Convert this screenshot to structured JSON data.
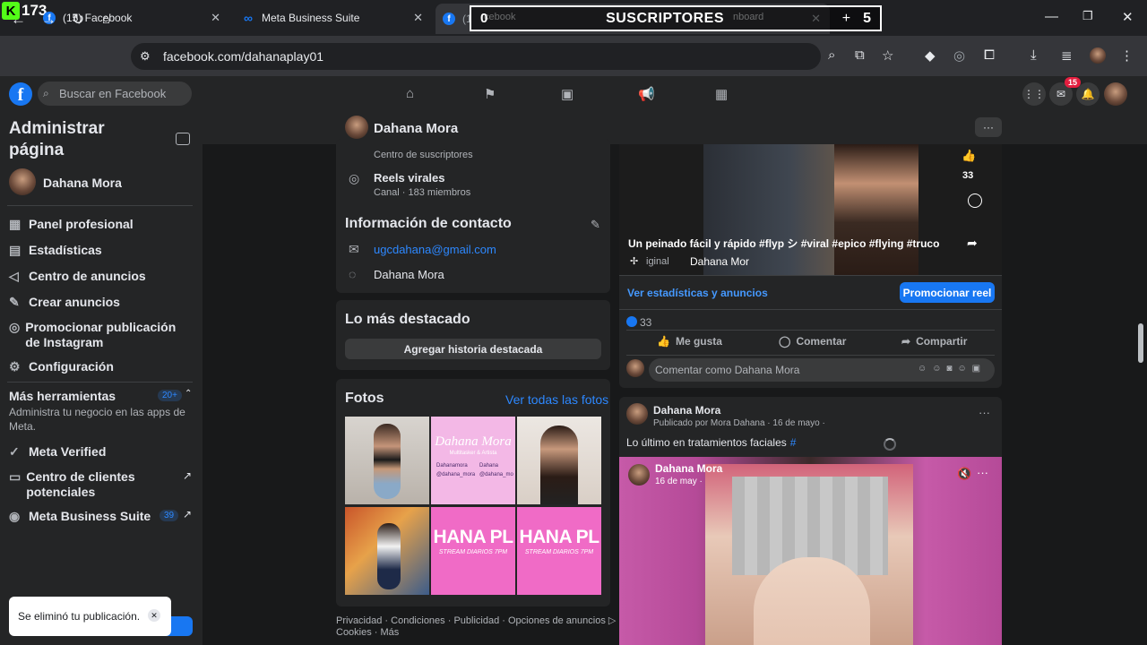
{
  "overlay": {
    "kick_count": "173",
    "subs_left": "0",
    "subs_label": "SUSCRIPTORES",
    "subs_right": "5"
  },
  "tabs": [
    {
      "title": "(15) Facebook"
    },
    {
      "title": "Meta Business Suite"
    },
    {
      "title": "(15) Facebook",
      "partial_prefix": "(1",
      "partial_suffix": "cebook",
      "hidden_suffix": "nboard"
    }
  ],
  "address": {
    "url": "facebook.com/dahanaplay01"
  },
  "fb": {
    "search_placeholder": "Buscar en Facebook",
    "messenger_badge": "15"
  },
  "sidebar": {
    "title": "Administrar página",
    "page_name": "Dahana Mora",
    "items": [
      {
        "label": "Panel profesional",
        "icon": "panel-icon"
      },
      {
        "label": "Estadísticas",
        "icon": "stats-icon"
      },
      {
        "label": "Centro de anuncios",
        "icon": "megaphone-icon"
      },
      {
        "label": "Crear anuncios",
        "icon": "edit-icon"
      },
      {
        "label": "Promocionar publicación de Instagram",
        "icon": "instagram-icon"
      },
      {
        "label": "Configuración",
        "icon": "gear-icon"
      }
    ],
    "more_tools": {
      "label": "Más herramientas",
      "badge": "20+",
      "desc": "Administra tu negocio en las apps de Meta."
    },
    "tools": [
      {
        "label": "Meta Verified",
        "icon": "verified-icon"
      },
      {
        "label": "Centro de clientes potenciales",
        "icon": "leads-icon"
      },
      {
        "label": "Meta Business Suite",
        "icon": "business-suite-icon",
        "badge": "39"
      }
    ]
  },
  "toast": {
    "text": "Se eliminó tu publicación."
  },
  "profile_header": {
    "name": "Dahana Mora"
  },
  "channels": [
    {
      "name": "Centro de suscriptores",
      "meta": ""
    },
    {
      "name": "Reels virales",
      "meta": "Canal · 183 miembros"
    }
  ],
  "contact": {
    "title": "Información de contacto",
    "email": "ugcdahana@gmail.com",
    "messenger": "Dahana Mora"
  },
  "featured": {
    "title": "Lo más destacado",
    "button": "Agregar historia destacada"
  },
  "photos": {
    "title": "Fotos",
    "see_all": "Ver todas las fotos",
    "p2_name": "Dahana Mora",
    "p2_sub": "Multitasker & Artista",
    "p2_line1": "Dahanamora",
    "p2_line2": "Dahana",
    "p2_line3": "@dahana_mora",
    "p2_line4": "@dahana_mo",
    "banner_text": "HANA PL",
    "banner_sub": "STREAM DIARIOS 7PM"
  },
  "footer": {
    "line1": "Privacidad · Condiciones · Publicidad · Opciones de anuncios ▷ ·",
    "line2": "Cookies · Más"
  },
  "reel": {
    "caption": "Un peinado fácil y rápido #flyp シ #viral #epico #flying #truco",
    "audio_prefix": "iginal",
    "audio_name": "Dahana Mor",
    "likes": "33",
    "stats_link": "Ver estadísticas y anuncios",
    "promote": "Promocionar reel",
    "reaction_count": "33",
    "like": "Me gusta",
    "comment": "Comentar",
    "share": "Compartir",
    "comment_placeholder": "Comentar como Dahana Mora"
  },
  "post": {
    "author": "Dahana Mora",
    "meta": "Publicado por Mora Dahana · 16 de mayo ·",
    "text": "Lo último en tratamientos faciales",
    "hashtag": "#",
    "inner_author": "Dahana Mora",
    "inner_date": "16 de may ·"
  }
}
